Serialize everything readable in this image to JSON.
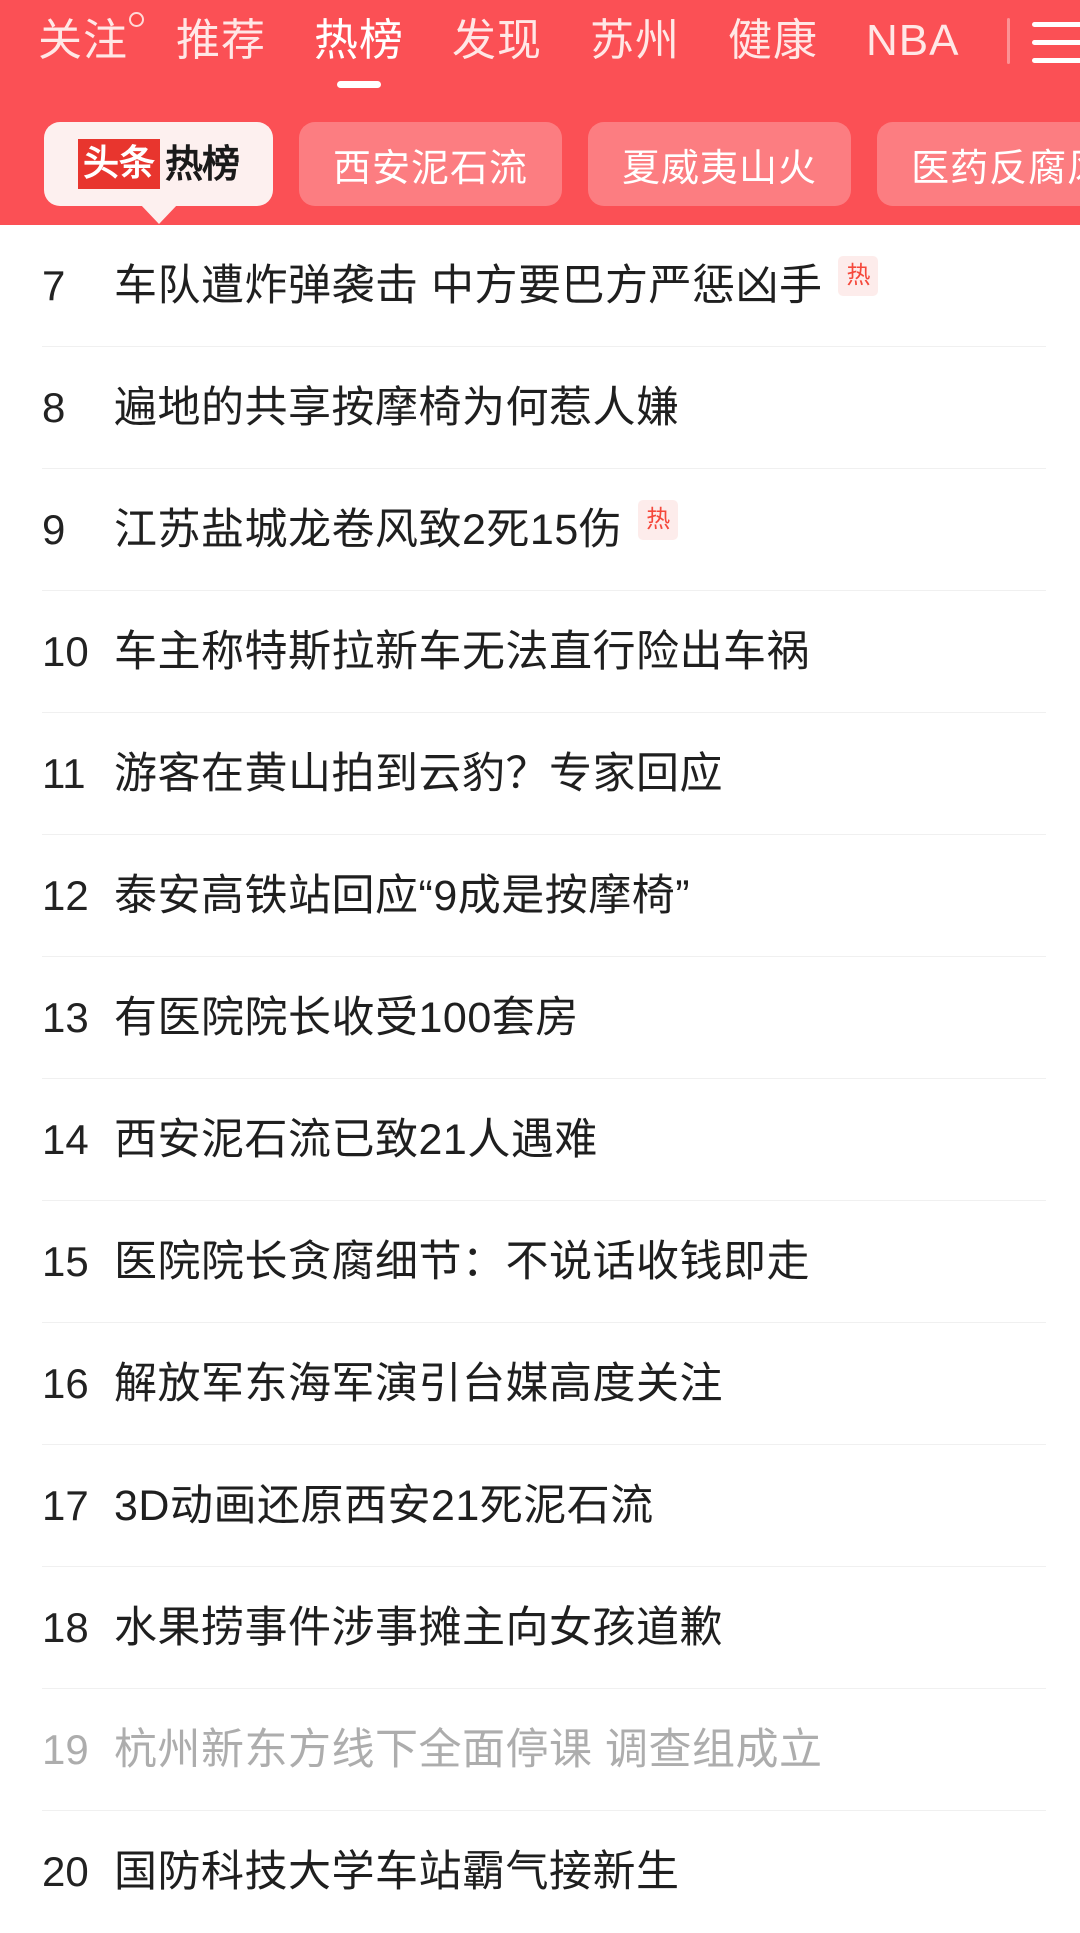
{
  "header": {
    "background_color": "#fb5055",
    "nav_tabs": [
      {
        "label": "关注",
        "active": false,
        "badge_dot": true
      },
      {
        "label": "推荐",
        "active": false,
        "badge_dot": false
      },
      {
        "label": "热榜",
        "active": true,
        "badge_dot": false
      },
      {
        "label": "发现",
        "active": false,
        "badge_dot": false
      },
      {
        "label": "苏州",
        "active": false,
        "badge_dot": false
      },
      {
        "label": "健康",
        "active": false,
        "badge_dot": false
      },
      {
        "label": "NBA",
        "active": false,
        "badge_dot": false
      }
    ],
    "menu_icon": "hamburger-menu-icon",
    "chips": [
      {
        "label": "头条热榜",
        "active": true,
        "logo_left": "头条",
        "logo_right": "热榜"
      },
      {
        "label": "西安泥石流",
        "active": false
      },
      {
        "label": "夏威夷山火",
        "active": false
      },
      {
        "label": "医药反腐风暴",
        "active": false
      }
    ]
  },
  "hot_list": {
    "badge_label": "热",
    "items": [
      {
        "rank": "7",
        "title": "车队遭炸弹袭击 中方要巴方严惩凶手",
        "hot": true,
        "read": false
      },
      {
        "rank": "8",
        "title": "遍地的共享按摩椅为何惹人嫌",
        "hot": false,
        "read": false
      },
      {
        "rank": "9",
        "title": "江苏盐城龙卷风致2死15伤",
        "hot": true,
        "read": false
      },
      {
        "rank": "10",
        "title": "车主称特斯拉新车无法直行险出车祸",
        "hot": false,
        "read": false
      },
      {
        "rank": "11",
        "title": "游客在黄山拍到云豹？专家回应",
        "hot": false,
        "read": false
      },
      {
        "rank": "12",
        "title": "泰安高铁站回应“9成是按摩椅”",
        "hot": false,
        "read": false
      },
      {
        "rank": "13",
        "title": "有医院院长收受100套房",
        "hot": false,
        "read": false
      },
      {
        "rank": "14",
        "title": "西安泥石流已致21人遇难",
        "hot": false,
        "read": false
      },
      {
        "rank": "15",
        "title": "医院院长贪腐细节：不说话收钱即走",
        "hot": false,
        "read": false
      },
      {
        "rank": "16",
        "title": "解放军东海军演引台媒高度关注",
        "hot": false,
        "read": false
      },
      {
        "rank": "17",
        "title": "3D动画还原西安21死泥石流",
        "hot": false,
        "read": false
      },
      {
        "rank": "18",
        "title": "水果捞事件涉事摊主向女孩道歉",
        "hot": false,
        "read": false
      },
      {
        "rank": "19",
        "title": "杭州新东方线下全面停课 调查组成立",
        "hot": false,
        "read": true
      },
      {
        "rank": "20",
        "title": "国防科技大学车站霸气接新生",
        "hot": false,
        "read": false
      }
    ]
  },
  "colors": {
    "brand_red": "#fb5055",
    "badge_bg": "#fdeceb",
    "badge_text": "#f5483b",
    "chip_active_bg": "#fdf0ef",
    "read_text": "#adadad"
  }
}
